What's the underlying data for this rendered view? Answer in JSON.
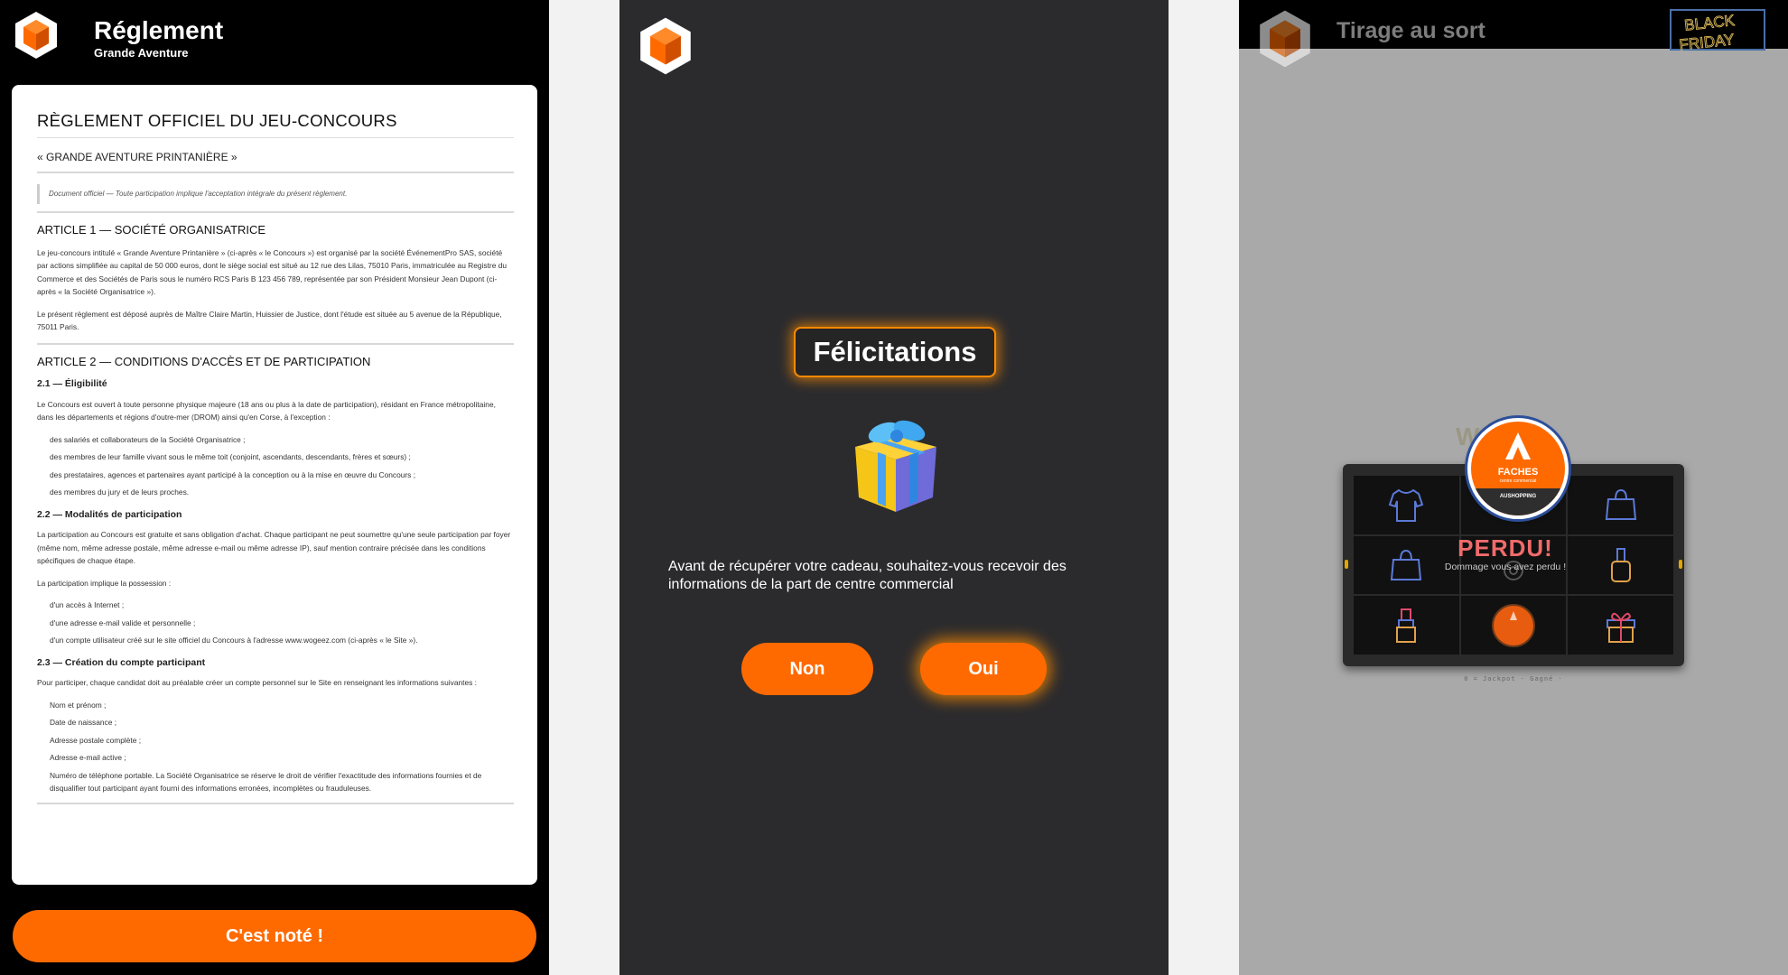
{
  "colors": {
    "accent": "#ff6a00",
    "panel_dark": "#2b2b2d",
    "overlay_grey": "#a9a9a9",
    "lost_red": "#f06b6b"
  },
  "reglement": {
    "header": {
      "title": "Réglement",
      "subtitle": "Grande Aventure",
      "logo_icon": "cube-hexagon-icon"
    },
    "doc": {
      "title": "RÈGLEMENT OFFICIEL DU JEU-CONCOURS",
      "subtitle": "« GRANDE AVENTURE PRINTANIÈRE »",
      "note": "Document officiel — Toute participation implique l'acceptation intégrale du présent règlement.",
      "a1_title": "ARTICLE 1 — SOCIÉTÉ ORGANISATRICE",
      "a1_p1": "Le jeu-concours intitulé « Grande Aventure Printanière » (ci-après « le Concours ») est organisé par la société ÉvénementPro SAS, société par actions simplifiée au capital de 50 000 euros, dont le siège social est situé au 12 rue des Lilas, 75010 Paris, immatriculée au Registre du Commerce et des Sociétés de Paris sous le numéro RCS Paris B 123 456 789, représentée par son Président Monsieur Jean Dupont (ci-après « la Société Organisatrice »).",
      "a1_p2": "Le présent règlement est déposé auprès de Maître Claire Martin, Huissier de Justice, dont l'étude est située au 5 avenue de la République, 75011 Paris.",
      "a2_title": "ARTICLE 2 — CONDITIONS D'ACCÈS ET DE PARTICIPATION",
      "s21_title": "2.1 — Éligibilité",
      "s21_p": "Le Concours est ouvert à toute personne physique majeure (18 ans ou plus à la date de participation), résidant en France métropolitaine, dans les départements et régions d'outre-mer (DROM) ainsi qu'en Corse, à l'exception :",
      "s21_list": [
        "des salariés et collaborateurs de la Société Organisatrice ;",
        "des membres de leur famille vivant sous le même toit (conjoint, ascendants, descendants, frères et sœurs) ;",
        "des prestataires, agences et partenaires ayant participé à la conception ou à la mise en œuvre du Concours ;",
        "des membres du jury et de leurs proches."
      ],
      "s22_title": "2.2 — Modalités de participation",
      "s22_p1": "La participation au Concours est gratuite et sans obligation d'achat. Chaque participant ne peut soumettre qu'une seule participation par foyer (même nom, même adresse postale, même adresse e-mail ou même adresse IP), sauf mention contraire précisée dans les conditions spécifiques de chaque étape.",
      "s22_p2": "La participation implique la possession :",
      "s22_list": [
        "d'un accès à Internet ;",
        "d'une adresse e-mail valide et personnelle ;",
        "d'un compte utilisateur créé sur le site officiel du Concours à l'adresse www.wogeez.com (ci-après « le Site »)."
      ],
      "s23_title": "2.3 — Création du compte participant",
      "s23_p": "Pour participer, chaque candidat doit au préalable créer un compte personnel sur le Site en renseignant les informations suivantes :",
      "s23_list": [
        "Nom et prénom ;",
        "Date de naissance ;",
        "Adresse postale complète ;",
        "Adresse e-mail active ;",
        "Numéro de téléphone portable. La Société Organisatrice se réserve le droit de vérifier l'exactitude des informations fournies et de disqualifier tout participant ayant fourni des informations erronées, incomplètes ou frauduleuses."
      ]
    },
    "button_label": "C'est noté !"
  },
  "felicitations": {
    "title": "Félicitations",
    "gift_icon": "gift-box-icon",
    "question": "Avant de récupérer votre cadeau, souhaitez-vous recevoir des informations de la part de centre commercial",
    "no_label": "Non",
    "yes_label": "Oui"
  },
  "tirage": {
    "title": "Tirage au sort",
    "promo_badge": "BLACK FRIDAY",
    "grid_icons": [
      "shirt-icon",
      "mall-logo-icon",
      "handbag-icon",
      "handbag-icon",
      "gear-icon",
      "nail-polish-icon",
      "lipstick-icon",
      "mall-logo-icon",
      "gift-icon"
    ],
    "result_title": "PERDU!",
    "result_message": "Dommage vous avez perdu !",
    "store_badge": {
      "name": "FACHES",
      "subtitle": "centre commercial",
      "band": "AUSHOPPING"
    },
    "legend": "0 = Jackpot · Gagné ·"
  }
}
